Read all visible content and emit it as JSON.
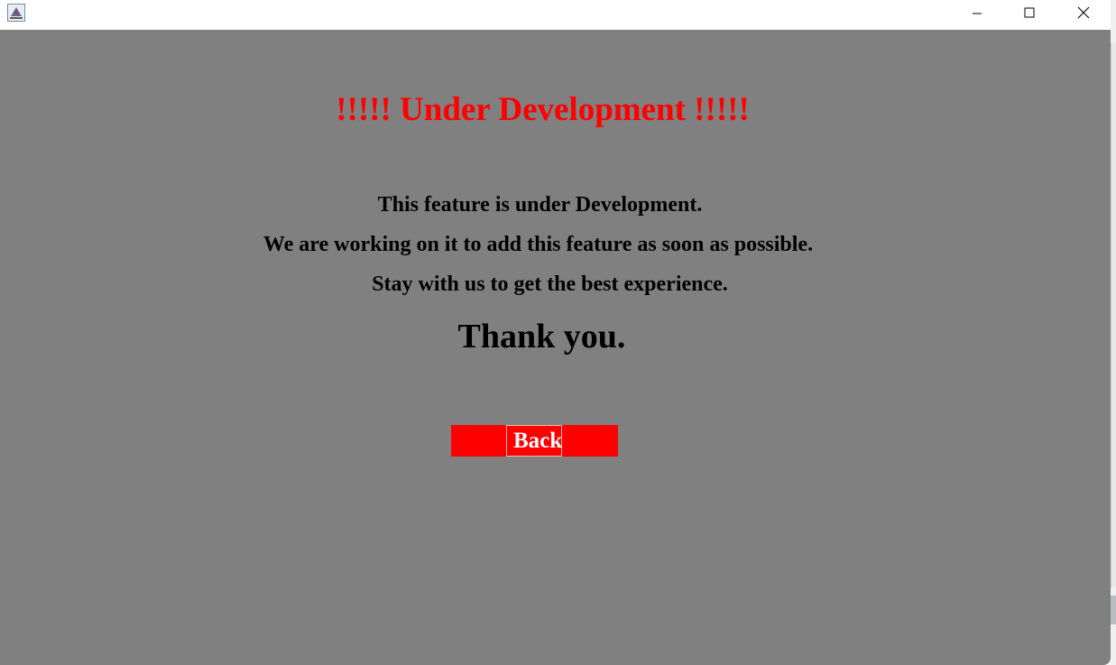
{
  "window": {
    "controls": {
      "minimize_icon": "minimize-icon",
      "maximize_icon": "maximize-icon",
      "close_icon": "close-icon"
    }
  },
  "content": {
    "heading": "!!!!! Under Development !!!!!",
    "message_line1": "This feature is under Development.",
    "message_line2": "We are working on it to add this feature as soon as possible.",
    "message_line3": "Stay with us to get the best experience.",
    "thanks": "Thank you.",
    "back_label": "Back"
  },
  "colors": {
    "background": "#808080",
    "heading": "#ff0000",
    "button": "#ff0000",
    "button_text": "#ffffff",
    "text": "#000000"
  }
}
